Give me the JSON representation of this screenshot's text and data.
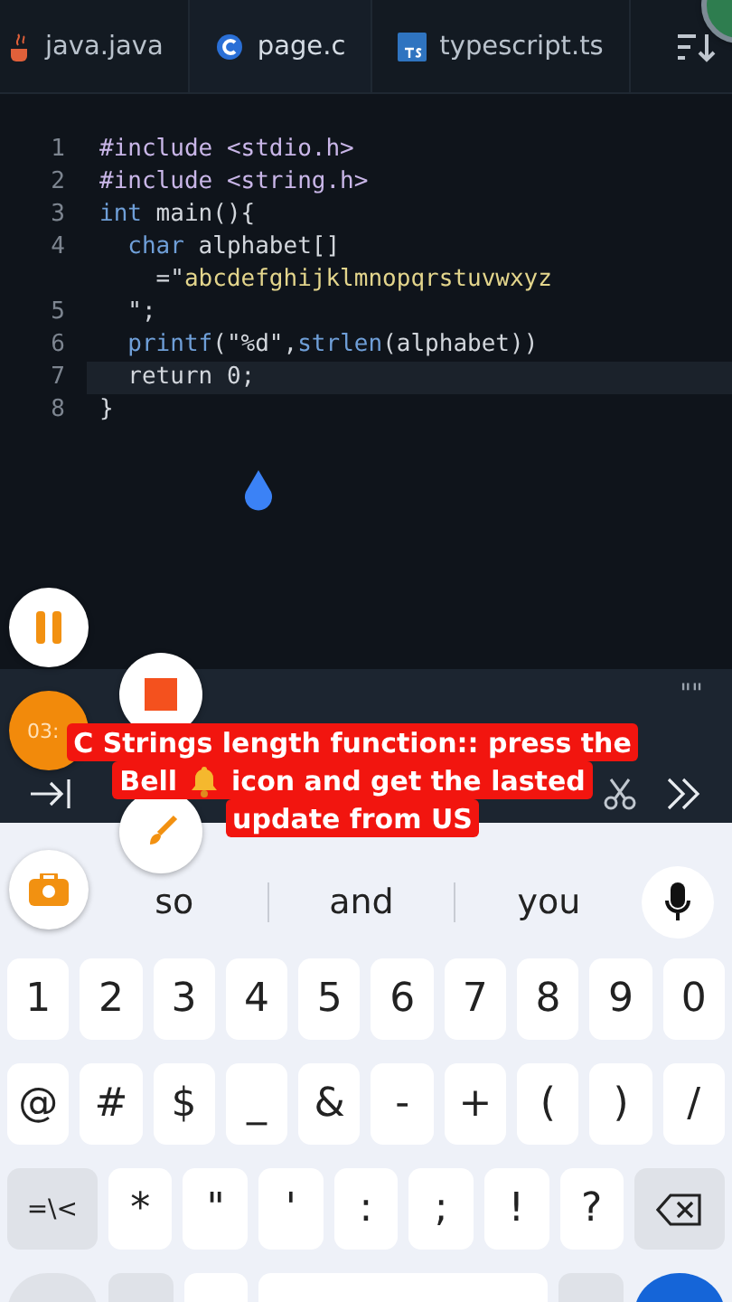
{
  "tabs": [
    {
      "label": "java.java",
      "kind": "java",
      "selected": false
    },
    {
      "label": "page.c",
      "kind": "c",
      "selected": true
    },
    {
      "label": "typescript.ts",
      "kind": "ts",
      "selected": false
    }
  ],
  "code": {
    "lines": [
      {
        "number": "1",
        "current": false,
        "tokens": [
          {
            "kind": "preproc",
            "text": "#include <stdio.h>"
          }
        ]
      },
      {
        "number": "2",
        "current": false,
        "tokens": [
          {
            "kind": "preproc",
            "text": "#include <string.h>"
          }
        ]
      },
      {
        "number": "3",
        "current": false,
        "tokens": [
          {
            "kind": "keyword",
            "text": "int"
          },
          {
            "kind": "plain",
            "text": " main(){"
          }
        ]
      },
      {
        "number": "4",
        "current": false,
        "tokens": [
          {
            "kind": "keyword",
            "text": "  char"
          },
          {
            "kind": "plain",
            "text": " alphabet[]"
          }
        ]
      },
      {
        "current": false,
        "tokens": [
          {
            "kind": "plain",
            "text": "    =\""
          },
          {
            "kind": "string",
            "text": "abcdefghijklmnopqrstuvwxyz"
          }
        ]
      },
      {
        "number": "5",
        "current": false,
        "tokens": [
          {
            "kind": "plain",
            "text": "  \";"
          }
        ]
      },
      {
        "number": "6",
        "current": false,
        "tokens": [
          {
            "kind": "function",
            "text": "  printf"
          },
          {
            "kind": "plain",
            "text": "(\"%d\","
          },
          {
            "kind": "function",
            "text": "strlen"
          },
          {
            "kind": "plain",
            "text": "(alphabet))"
          }
        ]
      },
      {
        "number": "7",
        "current": true,
        "tokens": [
          {
            "kind": "plain",
            "text": "  return 0;"
          }
        ]
      },
      {
        "number": "8",
        "current": false,
        "tokens": [
          {
            "kind": "plain",
            "text": "}"
          }
        ]
      }
    ]
  },
  "timer": "03:",
  "toolbar": {
    "quote": "\"\""
  },
  "caption": {
    "lines": [
      {
        "parts": [
          "C Strings length function:: press the"
        ]
      },
      {
        "parts": [
          "Bell",
          "icon and get the lasted"
        ]
      },
      {
        "parts": [
          "update from US"
        ]
      }
    ]
  },
  "suggestions": [
    "so",
    "and",
    "you"
  ],
  "keyboard": {
    "rows": [
      [
        {
          "label": "1"
        },
        {
          "label": "2"
        },
        {
          "label": "3"
        },
        {
          "label": "4"
        },
        {
          "label": "5"
        },
        {
          "label": "6"
        },
        {
          "label": "7"
        },
        {
          "label": "8"
        },
        {
          "label": "9"
        },
        {
          "label": "0"
        }
      ],
      [
        {
          "label": "@"
        },
        {
          "label": "#"
        },
        {
          "label": "$"
        },
        {
          "label": "_"
        },
        {
          "label": "&"
        },
        {
          "label": "-"
        },
        {
          "label": "+"
        },
        {
          "label": "("
        },
        {
          "label": ")"
        },
        {
          "label": "/"
        }
      ],
      [
        {
          "label": "=\\<",
          "kind": "function"
        },
        {
          "label": "*"
        },
        {
          "label": "\""
        },
        {
          "label": "'"
        },
        {
          "label": ":"
        },
        {
          "label": ";"
        },
        {
          "label": "!"
        },
        {
          "label": "?"
        },
        {
          "kind": "backspace"
        }
      ]
    ]
  }
}
